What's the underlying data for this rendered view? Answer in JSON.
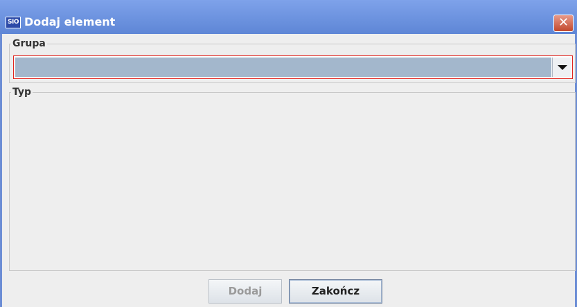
{
  "window": {
    "title": "Dodaj element",
    "app_icon_text": "SIO",
    "close_glyph": "✕"
  },
  "grupa": {
    "legend": "Grupa",
    "selected_value": "",
    "arrow_icon": "chevron-down-icon"
  },
  "typ": {
    "legend": "Typ"
  },
  "buttons": {
    "add_label": "Dodaj",
    "add_enabled": false,
    "finish_label": "Zakończ"
  },
  "colors": {
    "titlebar": "#6c8dd5",
    "combo_fill": "#a3b7cc",
    "combo_focus_border": "#e0251f",
    "close_button": "#c2482d"
  }
}
